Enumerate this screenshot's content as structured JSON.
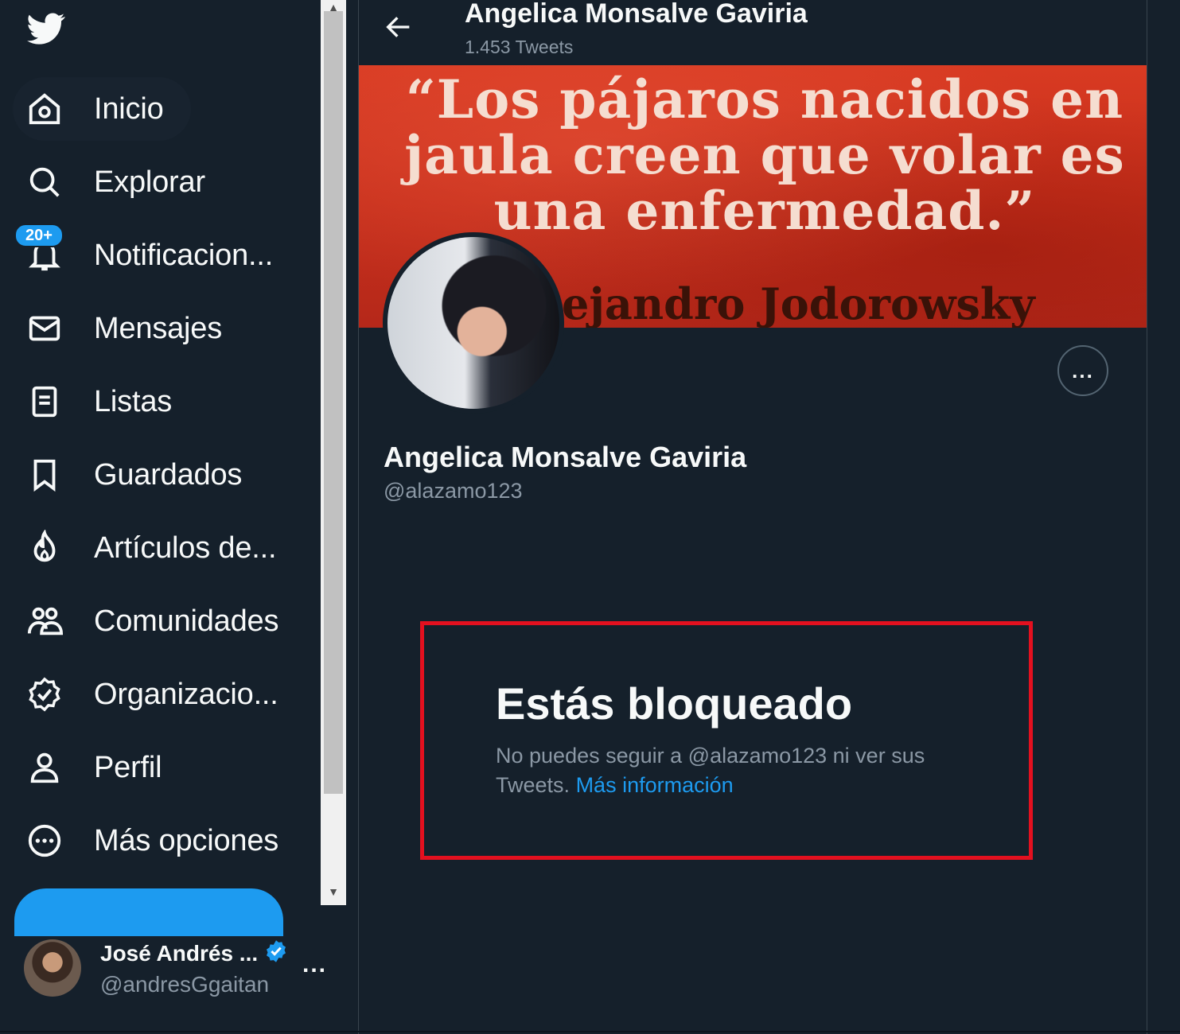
{
  "sidebar": {
    "nav": [
      {
        "label": "Inicio"
      },
      {
        "label": "Explorar"
      },
      {
        "label": "Notificacion...",
        "badge": "20+"
      },
      {
        "label": "Mensajes"
      },
      {
        "label": "Listas"
      },
      {
        "label": "Guardados"
      },
      {
        "label": "Artículos de..."
      },
      {
        "label": "Comunidades"
      },
      {
        "label": "Organizacio..."
      },
      {
        "label": "Perfil"
      },
      {
        "label": "Más opciones"
      }
    ],
    "account": {
      "name": "José Andrés ...",
      "handle": "@andresGgaitan",
      "more": "..."
    }
  },
  "header": {
    "name": "Angelica Monsalve Gaviria",
    "tweet_count": "1.453 Tweets"
  },
  "banner": {
    "quote": "“Los pájaros nacidos en jaula creen que volar es una enfermedad.”",
    "author": "ejandro Jodorowsky"
  },
  "profile": {
    "name": "Angelica Monsalve Gaviria",
    "handle": "@alazamo123",
    "more": "..."
  },
  "blocked": {
    "title": "Estás bloqueado",
    "description": "No puedes seguir a @alazamo123 ni ver sus Tweets.",
    "link": "Más información"
  },
  "colors": {
    "background": "#15202b",
    "accent": "#1d9bf0",
    "muted_text": "#8b98a5",
    "highlight_border": "#e3101f",
    "banner_red": "#c9301c"
  },
  "icons": [
    "twitter-logo-icon",
    "home-icon",
    "search-icon",
    "bell-icon",
    "mail-icon",
    "list-icon",
    "bookmark-icon",
    "fire-icon",
    "community-icon",
    "verified-org-icon",
    "person-icon",
    "more-circle-icon",
    "back-arrow-icon",
    "verified-badge-icon"
  ]
}
